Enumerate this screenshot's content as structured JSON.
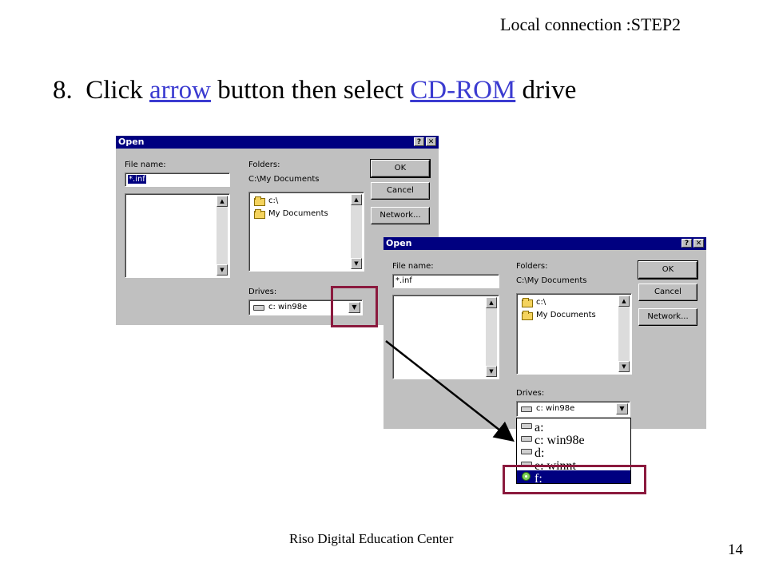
{
  "header": {
    "step_label": "Local connection :STEP2"
  },
  "instruction": {
    "number": "8.",
    "part1": "Click",
    "link1": "arrow",
    "part2": "button then select",
    "link2": "CD-ROM",
    "part3": "drive"
  },
  "dialog1": {
    "title": "Open",
    "help_btn": "?",
    "close_btn": "✕",
    "file_name_label": "File name:",
    "file_name_value": "*.inf",
    "folders_label": "Folders:",
    "folders_path": "C:\\My Documents",
    "folder_items": [
      "c:\\",
      "My Documents"
    ],
    "drives_label": "Drives:",
    "drive_value": "c: win98e",
    "buttons": {
      "ok": "OK",
      "cancel": "Cancel",
      "network": "Network..."
    }
  },
  "dialog2": {
    "title": "Open",
    "help_btn": "?",
    "close_btn": "✕",
    "file_name_label": "File name:",
    "file_name_value": "*.inf",
    "folders_label": "Folders:",
    "folders_path": "C:\\My Documents",
    "folder_items": [
      "c:\\",
      "My Documents"
    ],
    "drives_label": "Drives:",
    "drive_value": "c: win98e",
    "buttons": {
      "ok": "OK",
      "cancel": "Cancel",
      "network": "Network..."
    },
    "drive_list": [
      "a:",
      "c: win98e",
      "d:",
      "e: winnt",
      "f:"
    ],
    "selected_drive": "f:"
  },
  "footer": {
    "text": "Riso Digital Education Center",
    "page": "14"
  },
  "colors": {
    "highlight_box": "#8b1a3e",
    "link": "#3b3bd0",
    "titlebar": "#000080"
  }
}
